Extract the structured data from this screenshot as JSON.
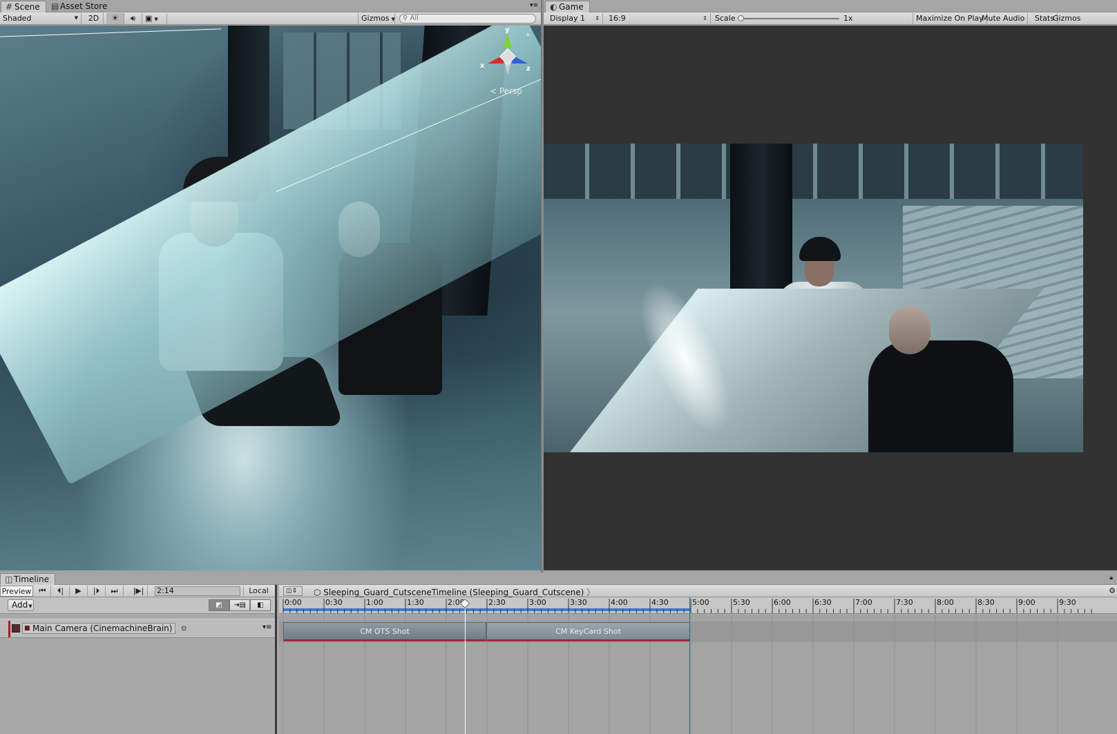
{
  "scene_tabs": [
    {
      "label": "Scene",
      "icon": "hash-icon"
    },
    {
      "label": "Asset Store",
      "icon": "bag-icon"
    }
  ],
  "scene_toolbar": {
    "shading_mode": "Shaded",
    "mode_2d": "2D",
    "gizmos_label": "Gizmos",
    "search_placeholder": "All"
  },
  "scene_view": {
    "gizmo_axes": {
      "x": "x",
      "y": "y",
      "z": "z"
    },
    "projection_label": "< Persp"
  },
  "game_tab": {
    "label": "Game",
    "icon": "pacman-icon"
  },
  "game_toolbar": {
    "display": "Display 1",
    "aspect": "16:9",
    "scale_label": "Scale",
    "scale_value": "1x",
    "maximize": "Maximize On Play",
    "mute": "Mute Audio",
    "stats": "Stats",
    "gizmos": "Gizmos"
  },
  "timeline": {
    "tab_label": "Timeline",
    "preview_label": "Preview",
    "current_time": "2:14",
    "local_label": "Local",
    "breadcrumb": "Sleeping_Guard_CutsceneTimeline (Sleeping_Guard_Cutscene)",
    "add_label": "Add",
    "track": {
      "binding": "Main Camera (CinemachineBrain)",
      "color": "#b0182a"
    },
    "ruler_labels": [
      "0:00",
      "0:30",
      "1:00",
      "1:30",
      "2:00",
      "2:30",
      "3:00",
      "3:30",
      "4:00",
      "4:30",
      "5:00",
      "5:30",
      "6:00",
      "6:30",
      "7:00",
      "7:30",
      "8:00",
      "8:30",
      "9:00",
      "9:30"
    ],
    "clips": [
      {
        "label": "CM OTS Shot"
      },
      {
        "label": "CM KeyCard Shot"
      }
    ]
  },
  "colors": {
    "unity_panel": "#a2a2a2",
    "toolbar": "#c8c8c8",
    "game_bg": "#323232",
    "playhead": "#ffffff",
    "end_marker": "#2a64b8"
  }
}
